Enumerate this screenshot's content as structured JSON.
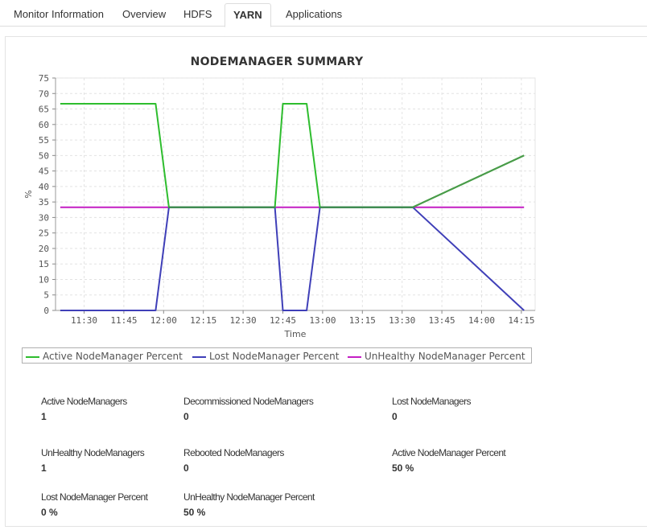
{
  "tabs": [
    {
      "label": "Monitor Information"
    },
    {
      "label": "Overview"
    },
    {
      "label": "HDFS"
    },
    {
      "label": "YARN"
    },
    {
      "label": "Applications"
    }
  ],
  "chart_data": {
    "type": "line",
    "title": "NODEMANAGER SUMMARY",
    "xlabel": "Time",
    "ylabel": "%",
    "ylim": [
      0,
      75
    ],
    "yticks": [
      0,
      5,
      10,
      15,
      20,
      25,
      30,
      35,
      40,
      45,
      50,
      55,
      60,
      65,
      70,
      75
    ],
    "xticks": [
      "11:30",
      "11:45",
      "12:00",
      "12:15",
      "12:30",
      "12:45",
      "13:00",
      "13:15",
      "13:30",
      "13:45",
      "14:00",
      "14:15"
    ],
    "x_start": "11:30",
    "legend_position": "bottom",
    "grid": true,
    "series": [
      {
        "name": "Active NodeManager Percent",
        "color": "#2ebd2e",
        "points": [
          [
            "11:21",
            66.7
          ],
          [
            "11:57",
            66.7
          ],
          [
            "12:02",
            33.3
          ],
          [
            "12:42",
            33.3
          ],
          [
            "12:45",
            66.7
          ],
          [
            "12:54",
            66.7
          ],
          [
            "12:59",
            33.3
          ],
          [
            "13:34",
            33.3
          ],
          [
            "14:16",
            50
          ]
        ]
      },
      {
        "name": "Lost NodeManager Percent",
        "color": "#3f3fb8",
        "points": [
          [
            "11:21",
            0
          ],
          [
            "11:57",
            0
          ],
          [
            "12:02",
            33.3
          ],
          [
            "12:42",
            33.3
          ],
          [
            "12:45",
            0
          ],
          [
            "12:54",
            0
          ],
          [
            "12:59",
            33.3
          ],
          [
            "13:34",
            33.3
          ],
          [
            "14:16",
            0
          ]
        ]
      },
      {
        "name": "UnHealthy NodeManager Percent",
        "color": "#c41ec4",
        "points": [
          [
            "11:21",
            33.3
          ],
          [
            "14:16",
            33.3
          ]
        ]
      }
    ]
  },
  "stats": [
    {
      "label": "Active NodeManagers",
      "value": "1"
    },
    {
      "label": "Decommissioned NodeManagers",
      "value": "0"
    },
    {
      "label": "Lost NodeManagers",
      "value": "0"
    },
    {
      "label": "UnHealthy NodeManagers",
      "value": "1"
    },
    {
      "label": "Rebooted NodeManagers",
      "value": "0"
    },
    {
      "label": "Active NodeManager Percent",
      "value": "50 %"
    },
    {
      "label": "Lost NodeManager Percent",
      "value": "0 %"
    },
    {
      "label": "UnHealthy NodeManager Percent",
      "value": "50 %"
    }
  ]
}
